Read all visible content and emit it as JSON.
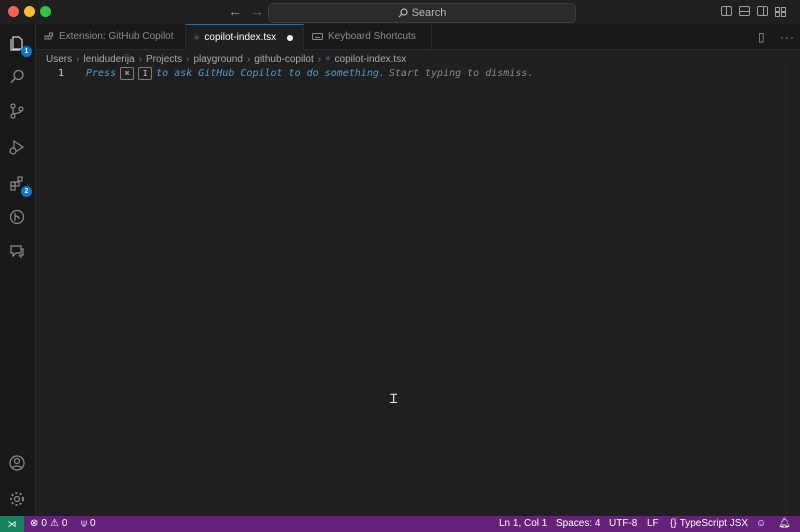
{
  "titlebar": {
    "search_placeholder": "Search",
    "icons": [
      "back-arrow-icon",
      "forward-arrow-icon",
      "search-icon",
      "toggle-sidebar-icon",
      "toggle-panel-icon",
      "toggle-secondary-sidebar-icon",
      "customize-layout-icon"
    ]
  },
  "activity_bar": {
    "explorer_badge": "1",
    "extensions_badge": "2"
  },
  "tabs": [
    {
      "label": "Extension: GitHub Copilot",
      "active": false
    },
    {
      "label": "copilot-index.tsx",
      "active": true,
      "modified": true
    },
    {
      "label": "Keyboard Shortcuts",
      "active": false
    }
  ],
  "breadcrumb": [
    "Users",
    "leniduderija",
    "Projects",
    "playground",
    "github-copilot",
    "copilot-index.tsx"
  ],
  "editor": {
    "line_number": "1",
    "hint": {
      "press": "Press",
      "key1": "⌘",
      "key2": "I",
      "mid": "to ask GitHub Copilot to do something.",
      "tail": "Start typing to dismiss."
    }
  },
  "statusbar": {
    "errors": "0",
    "warnings": "0",
    "ports": "0",
    "position": "Ln 1, Col 1",
    "spaces": "Spaces: 4",
    "encoding": "UTF-8",
    "eol": "LF",
    "language": "TypeScript JSX"
  },
  "colors": {
    "statusbar": "#68217a",
    "accent": "#0078d4",
    "remote": "#16825d"
  }
}
